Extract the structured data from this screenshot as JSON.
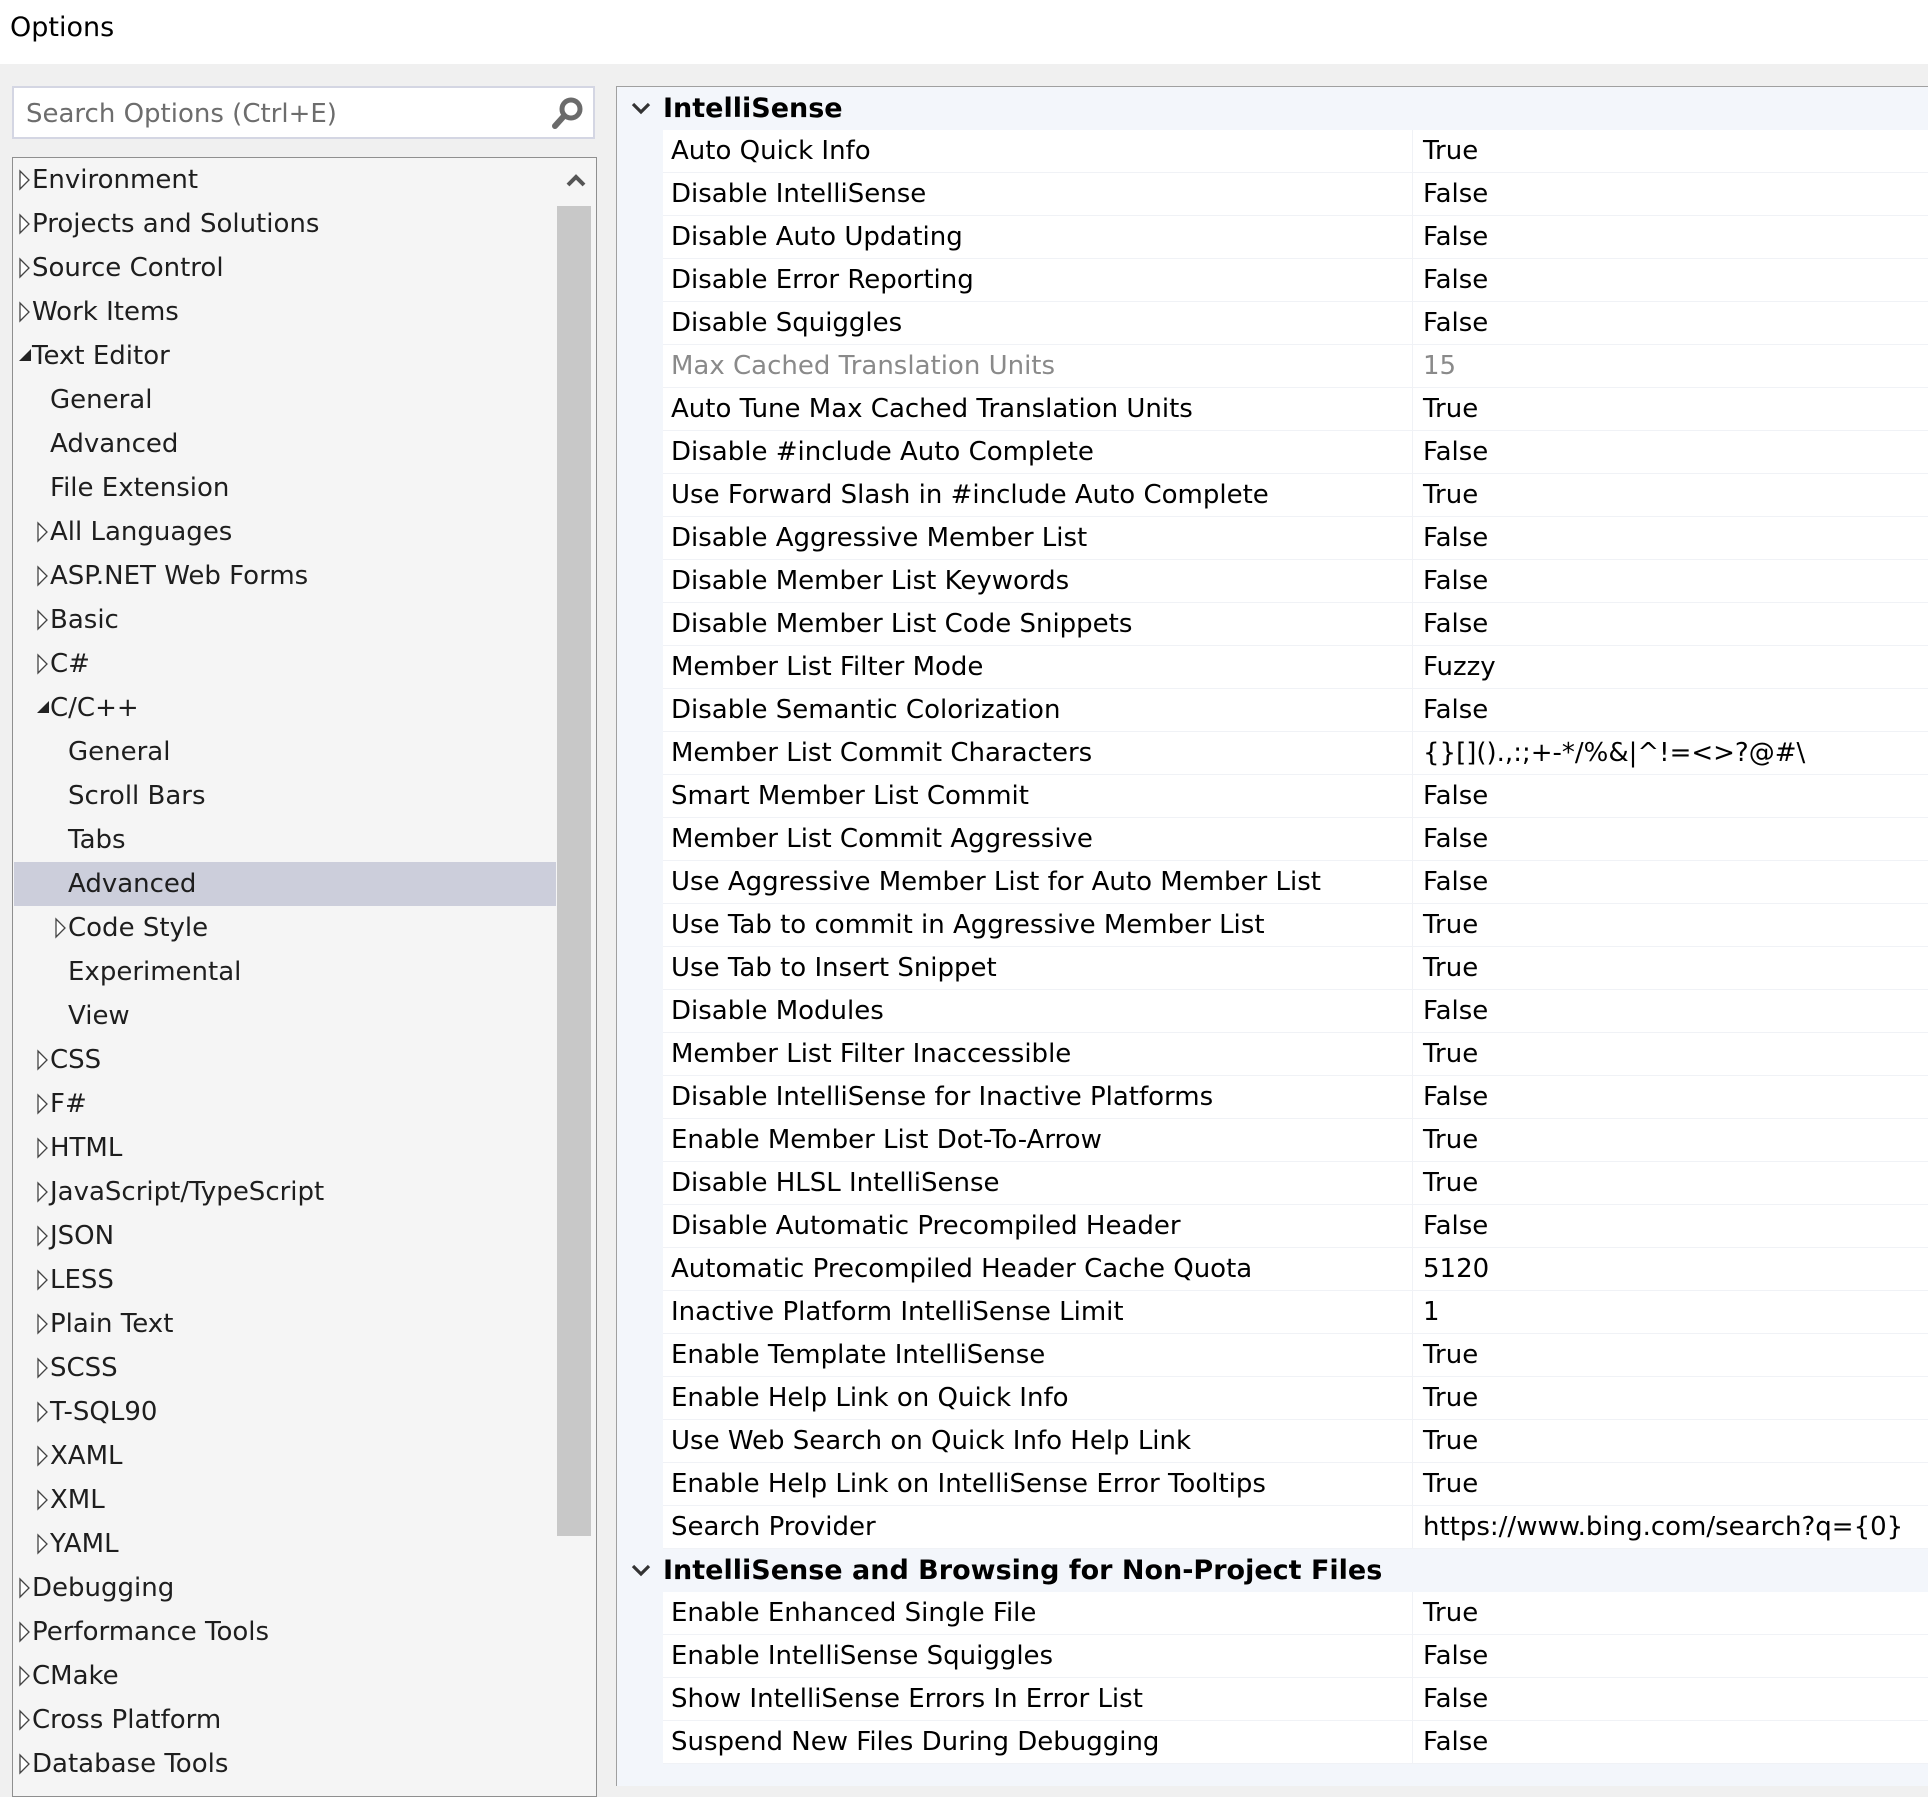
{
  "window": {
    "title": "Options"
  },
  "search": {
    "placeholder": "Search Options (Ctrl+E)",
    "icon": "search-icon"
  },
  "tree": {
    "items": [
      {
        "label": "Environment",
        "level": 0,
        "state": "collapsed"
      },
      {
        "label": "Projects and Solutions",
        "level": 0,
        "state": "collapsed"
      },
      {
        "label": "Source Control",
        "level": 0,
        "state": "collapsed"
      },
      {
        "label": "Work Items",
        "level": 0,
        "state": "collapsed"
      },
      {
        "label": "Text Editor",
        "level": 0,
        "state": "expanded"
      },
      {
        "label": "General",
        "level": 1,
        "state": "leaf"
      },
      {
        "label": "Advanced",
        "level": 1,
        "state": "leaf"
      },
      {
        "label": "File Extension",
        "level": 1,
        "state": "leaf"
      },
      {
        "label": "All Languages",
        "level": 1,
        "state": "collapsed"
      },
      {
        "label": "ASP.NET Web Forms",
        "level": 1,
        "state": "collapsed"
      },
      {
        "label": "Basic",
        "level": 1,
        "state": "collapsed"
      },
      {
        "label": "C#",
        "level": 1,
        "state": "collapsed"
      },
      {
        "label": "C/C++",
        "level": 1,
        "state": "expanded"
      },
      {
        "label": "General",
        "level": 2,
        "state": "leaf"
      },
      {
        "label": "Scroll Bars",
        "level": 2,
        "state": "leaf"
      },
      {
        "label": "Tabs",
        "level": 2,
        "state": "leaf"
      },
      {
        "label": "Advanced",
        "level": 2,
        "state": "leaf",
        "selected": true
      },
      {
        "label": "Code Style",
        "level": 2,
        "state": "collapsed"
      },
      {
        "label": "Experimental",
        "level": 2,
        "state": "leaf"
      },
      {
        "label": "View",
        "level": 2,
        "state": "leaf"
      },
      {
        "label": "CSS",
        "level": 1,
        "state": "collapsed"
      },
      {
        "label": "F#",
        "level": 1,
        "state": "collapsed"
      },
      {
        "label": "HTML",
        "level": 1,
        "state": "collapsed"
      },
      {
        "label": "JavaScript/TypeScript",
        "level": 1,
        "state": "collapsed"
      },
      {
        "label": "JSON",
        "level": 1,
        "state": "collapsed"
      },
      {
        "label": "LESS",
        "level": 1,
        "state": "collapsed"
      },
      {
        "label": "Plain Text",
        "level": 1,
        "state": "collapsed"
      },
      {
        "label": "SCSS",
        "level": 1,
        "state": "collapsed"
      },
      {
        "label": "T-SQL90",
        "level": 1,
        "state": "collapsed"
      },
      {
        "label": "XAML",
        "level": 1,
        "state": "collapsed"
      },
      {
        "label": "XML",
        "level": 1,
        "state": "collapsed"
      },
      {
        "label": "YAML",
        "level": 1,
        "state": "collapsed"
      },
      {
        "label": "Debugging",
        "level": 0,
        "state": "collapsed"
      },
      {
        "label": "Performance Tools",
        "level": 0,
        "state": "collapsed"
      },
      {
        "label": "CMake",
        "level": 0,
        "state": "collapsed"
      },
      {
        "label": "Cross Platform",
        "level": 0,
        "state": "collapsed"
      },
      {
        "label": "Database Tools",
        "level": 0,
        "state": "collapsed"
      }
    ]
  },
  "properties": {
    "categories": [
      {
        "label": "IntelliSense",
        "expanded": true,
        "rows": [
          {
            "name": "Auto Quick Info",
            "value": "True"
          },
          {
            "name": "Disable IntelliSense",
            "value": "False"
          },
          {
            "name": "Disable Auto Updating",
            "value": "False"
          },
          {
            "name": "Disable Error Reporting",
            "value": "False"
          },
          {
            "name": "Disable Squiggles",
            "value": "False"
          },
          {
            "name": "Max Cached Translation Units",
            "value": "15",
            "disabled": true
          },
          {
            "name": "Auto Tune Max Cached Translation Units",
            "value": "True"
          },
          {
            "name": "Disable #include Auto Complete",
            "value": "False"
          },
          {
            "name": "Use Forward Slash in #include Auto Complete",
            "value": "True"
          },
          {
            "name": "Disable Aggressive Member List",
            "value": "False"
          },
          {
            "name": "Disable Member List Keywords",
            "value": "False"
          },
          {
            "name": "Disable Member List Code Snippets",
            "value": "False"
          },
          {
            "name": "Member List Filter Mode",
            "value": "Fuzzy"
          },
          {
            "name": "Disable Semantic Colorization",
            "value": "False"
          },
          {
            "name": "Member List Commit Characters",
            "value": "{}[]().,:;+-*/%&|^!=<>?@#\\"
          },
          {
            "name": "Smart Member List Commit",
            "value": "False"
          },
          {
            "name": "Member List Commit Aggressive",
            "value": "False"
          },
          {
            "name": "Use Aggressive Member List for Auto Member List",
            "value": "False"
          },
          {
            "name": "Use Tab to commit in Aggressive Member List",
            "value": "True"
          },
          {
            "name": "Use Tab to Insert Snippet",
            "value": "True"
          },
          {
            "name": "Disable Modules",
            "value": "False"
          },
          {
            "name": "Member List Filter Inaccessible",
            "value": "True"
          },
          {
            "name": "Disable IntelliSense for Inactive Platforms",
            "value": "False"
          },
          {
            "name": "Enable Member List Dot-To-Arrow",
            "value": "True"
          },
          {
            "name": "Disable HLSL IntelliSense",
            "value": "True"
          },
          {
            "name": "Disable Automatic Precompiled Header",
            "value": "False"
          },
          {
            "name": "Automatic Precompiled Header Cache Quota",
            "value": "5120"
          },
          {
            "name": "Inactive Platform IntelliSense Limit",
            "value": "1"
          },
          {
            "name": "Enable Template IntelliSense",
            "value": "True"
          },
          {
            "name": "Enable Help Link on Quick Info",
            "value": "True"
          },
          {
            "name": "Use Web Search on Quick Info Help Link",
            "value": "True"
          },
          {
            "name": "Enable Help Link on IntelliSense Error Tooltips",
            "value": "True"
          },
          {
            "name": "Search Provider",
            "value": "https://www.bing.com/search?q={0}"
          }
        ]
      },
      {
        "label": "IntelliSense and Browsing for Non-Project Files",
        "expanded": true,
        "rows": [
          {
            "name": "Enable Enhanced Single File",
            "value": "True"
          },
          {
            "name": "Enable IntelliSense Squiggles",
            "value": "False"
          },
          {
            "name": "Show IntelliSense Errors In Error List",
            "value": "False"
          },
          {
            "name": "Suspend New Files During Debugging",
            "value": "False"
          }
        ]
      }
    ]
  }
}
